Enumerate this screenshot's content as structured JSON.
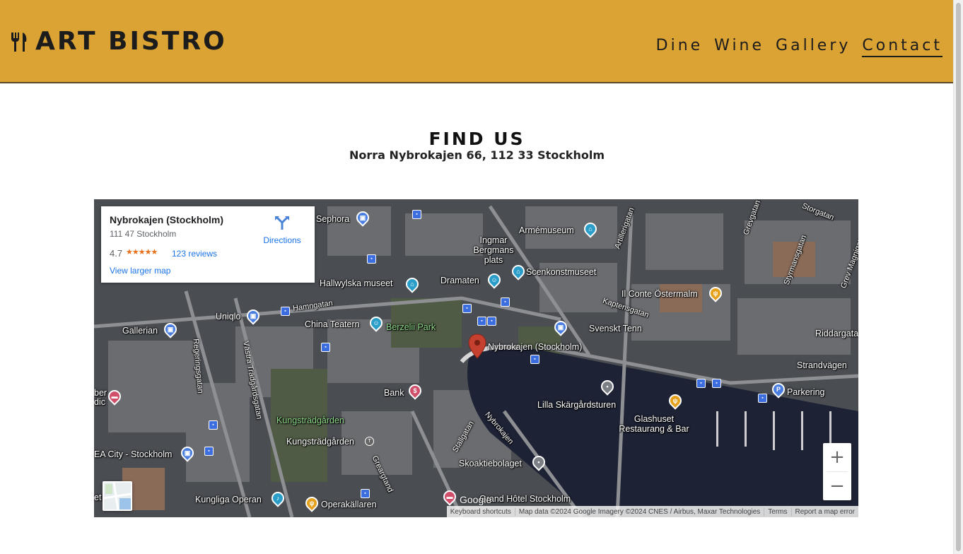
{
  "brand": {
    "name": "ART BISTRO",
    "icon": "fork-knife-icon"
  },
  "nav": {
    "items": [
      "Dine",
      "Wine",
      "Gallery",
      "Contact"
    ],
    "active": "Contact"
  },
  "section": {
    "title": "FIND US",
    "address": "Norra Nybrokajen 66, 112 33 Stockholm"
  },
  "map": {
    "place_card": {
      "name": "Nybrokajen (Stockholm)",
      "address": "111 47 Stockholm",
      "rating": "4.7",
      "stars": "★★★★★",
      "reviews": "123 reviews",
      "larger_map": "View larger map",
      "directions": "Directions"
    },
    "marker_label": "Nybrokajen (Stockholm)",
    "places": [
      "Sephora",
      "Ingmar Bergmans plats",
      "Armémuseum",
      "Scenkonstmuseet",
      "Hallwylska museet",
      "Dramaten",
      "Il Conte Östermalm",
      "Uniqlo",
      "China Teatern",
      "Berzelii Park",
      "Svenskt Tenn",
      "Gallerian",
      "Bank",
      "Strandvägen",
      "Parkering",
      "Lilla Skärgårdsturen",
      "Glashuset Restaurang & Bar",
      "Kungsträdgården",
      "Skoaktiebolaget",
      "Kungliga Operan",
      "Operakällaren",
      "Grand Hôtel Stockholm",
      "Riddargatan"
    ],
    "streets": [
      "Hamngatan",
      "Regeringsgatan",
      "Västra Trädgårdsgatan",
      "Kaptensgatan",
      "Artillerigatan",
      "Grevgatan",
      "Storgatan",
      "Styrmansgatan",
      "Grev Magnigatan",
      "Stallgatan",
      "Nybrokajen",
      "Greargtand"
    ],
    "left_edge_labels": [
      "ber dic",
      "EA City - Stockholm",
      "et"
    ],
    "kungstradgarden_station": "Kungsträdgården",
    "google_logo": "Google",
    "footer": [
      "Keyboard shortcuts",
      "Map data ©2024 Google Imagery ©2024 CNES / Airbus, Maxar Technologies",
      "Terms",
      "Report a map error"
    ],
    "zoom_in": "+",
    "zoom_out": "−"
  }
}
